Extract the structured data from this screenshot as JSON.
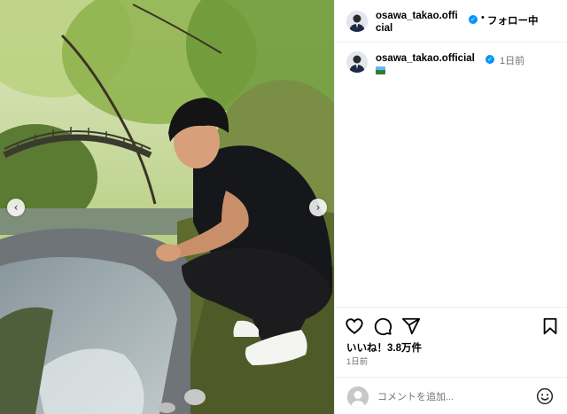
{
  "header": {
    "username": "osawa_takao.official",
    "separator": "•",
    "follow_label": "フォロー中",
    "verified_mark": "✓"
  },
  "caption": {
    "username": "osawa_takao.official",
    "time": "1日前",
    "emoji_icon": "landscape-emoji-icon"
  },
  "carousel": {
    "prev_arrow": "‹",
    "next_arrow": "›"
  },
  "actions": {
    "icons": [
      "heart-icon",
      "comment-icon",
      "share-icon",
      "bookmark-icon"
    ],
    "likes": "いいね！3.8万件",
    "time": "1日前"
  },
  "comment": {
    "placeholder": "コメントを追加..."
  },
  "colors": {
    "verified": "#0095f6",
    "muted_text": "#737373",
    "divider": "#efefef"
  }
}
